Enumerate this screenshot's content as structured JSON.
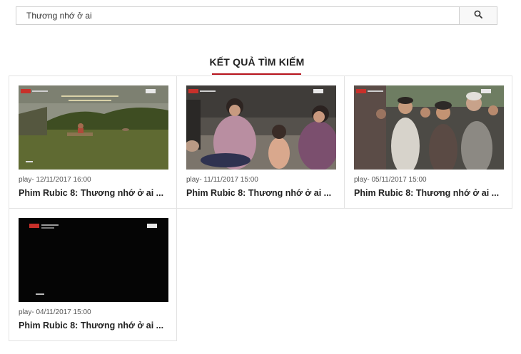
{
  "search": {
    "value": "Thương nhớ ở ai",
    "icon": "search-icon"
  },
  "section": {
    "title": "KẾT QUẢ TÌM KIẾM"
  },
  "colors": {
    "accent": "#b5121b",
    "border": "#e3e3e3"
  },
  "results": [
    {
      "date": "play- 12/11/2017 16:00",
      "title": "Phim Rubic 8: Thương nhớ ở ai ..."
    },
    {
      "date": "play- 11/11/2017 15:00",
      "title": "Phim Rubic 8: Thương nhớ ở ai ..."
    },
    {
      "date": "play- 05/11/2017 15:00",
      "title": "Phim Rubic 8: Thương nhớ ở ai ..."
    },
    {
      "date": "play- 04/11/2017 15:00",
      "title": "Phim Rubic 8: Thương nhớ ở ai ..."
    }
  ]
}
